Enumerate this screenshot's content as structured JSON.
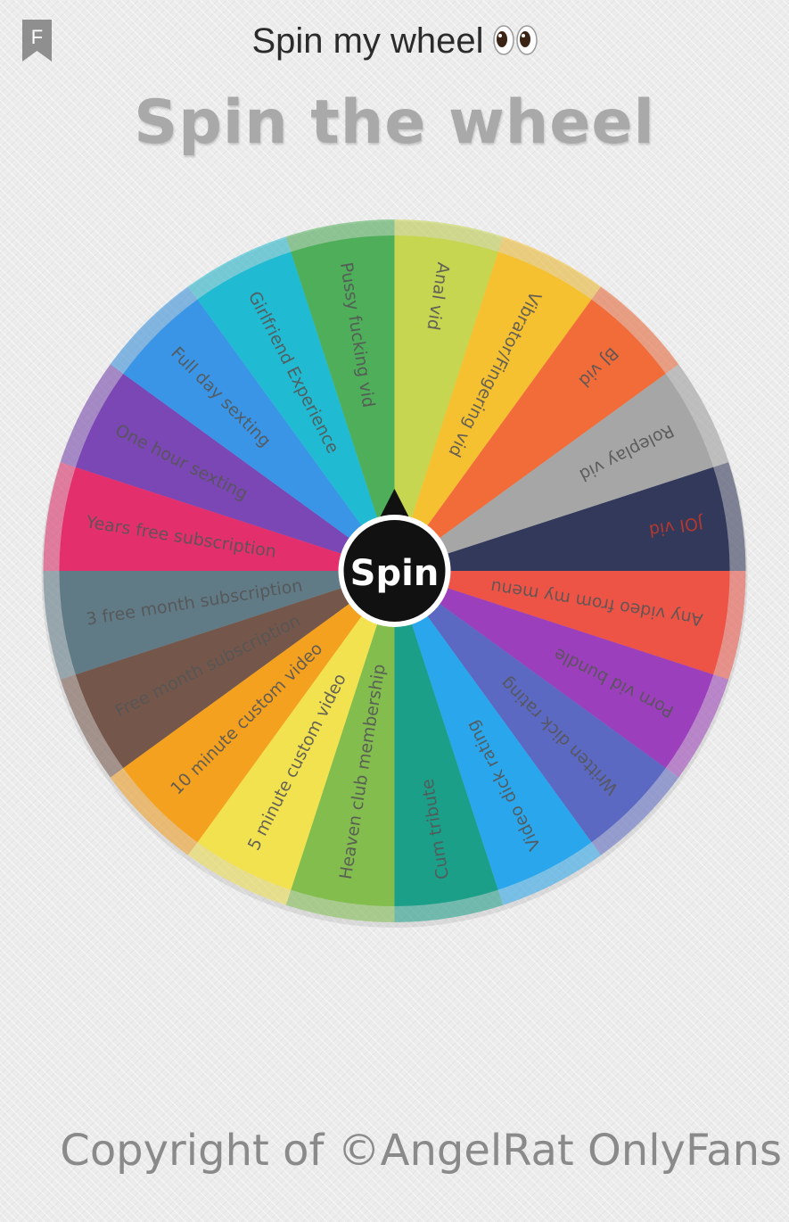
{
  "header": {
    "title": "Spin my wheel",
    "title_emoji": "eyes-emoji",
    "bookmark_letter": "F",
    "bookmark_icon": "bookmark-icon"
  },
  "heading": "Spin the wheel",
  "spin_button": {
    "label": "Spin"
  },
  "wheel": {
    "segments": [
      {
        "label": "Anal vid",
        "color": "#c6d651",
        "text_color": "#555555"
      },
      {
        "label": "Vibrator/Fingering vid",
        "color": "#f6c131",
        "text_color": "#555555"
      },
      {
        "label": "BJ vid",
        "color": "#f26c3a",
        "text_color": "#555555"
      },
      {
        "label": "Roleplay vid",
        "color": "#a6a6a6",
        "text_color": "#555555"
      },
      {
        "label": "JOI vid",
        "color": "#33395a",
        "text_color": "#c0392b"
      },
      {
        "label": "Any video from my menu",
        "color": "#ee5446",
        "text_color": "#555555"
      },
      {
        "label": "Porn vid bundle",
        "color": "#9c3fbc",
        "text_color": "#555555"
      },
      {
        "label": "Written dick rating",
        "color": "#5b69c3",
        "text_color": "#555555"
      },
      {
        "label": "Video dick rating",
        "color": "#2aa7ec",
        "text_color": "#555555"
      },
      {
        "label": "Cum tribute",
        "color": "#1c9f89",
        "text_color": "#555555"
      },
      {
        "label": "Heaven club membership",
        "color": "#82bd4e",
        "text_color": "#555555"
      },
      {
        "label": "5 minute custom video",
        "color": "#f3e24f",
        "text_color": "#555555"
      },
      {
        "label": "10 minute custom video",
        "color": "#f5a120",
        "text_color": "#555555"
      },
      {
        "label": "Free month subscription",
        "color": "#74574a",
        "text_color": "#555555"
      },
      {
        "label": "3 free month subscription",
        "color": "#607a86",
        "text_color": "#555555"
      },
      {
        "label": "Years free subscription",
        "color": "#e3306d",
        "text_color": "#555555"
      },
      {
        "label": "One hour sexting",
        "color": "#7a47b5",
        "text_color": "#555555"
      },
      {
        "label": "Full day sexting",
        "color": "#3b95e6",
        "text_color": "#555555"
      },
      {
        "label": "Girlfriend Experience",
        "color": "#20bbd2",
        "text_color": "#555555"
      },
      {
        "label": "Pussy fucking vid",
        "color": "#4eae59",
        "text_color": "#555555"
      }
    ]
  },
  "copyright": "Copyright of ©AngelRat OnlyFans"
}
